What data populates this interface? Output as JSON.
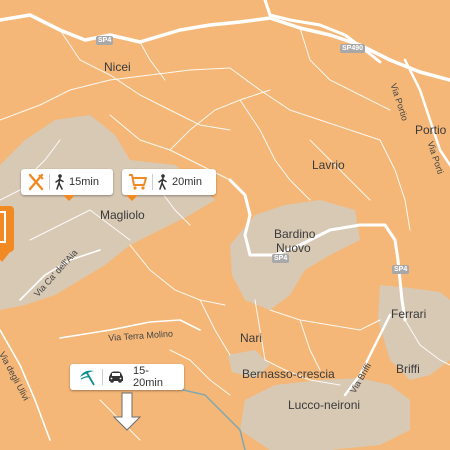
{
  "places": {
    "nicei": "Nicei",
    "lavrio": "Lavrio",
    "portio": "Portio",
    "magliolo": "Magliolo",
    "bardino_nuovo_line1": "Bardino",
    "bardino_nuovo_line2": "Nuovo",
    "ferrari": "Ferrari",
    "nari": "Nari",
    "briffi": "Briffi",
    "bernasso": "Bernasso-crescia",
    "lucco": "Lucco-neironi"
  },
  "roads": {
    "sp4_top": "SP4",
    "sp490": "SP490",
    "sp4_mid": "SP4",
    "sp4_right": "SP4",
    "via_portio_a": "Via Portio",
    "via_portio_b": "Via Porti",
    "via_ca_dellaia": "Via Ca' dell'Aia",
    "via_terra_molino": "Via Terra Molino",
    "via_degli_ulivi": "Via degli Ulivi",
    "via_briffi": "Via Briffi"
  },
  "chips": {
    "restaurant_walk": {
      "icon": "restaurant-icon",
      "mode_icon": "walking-icon",
      "time": "15min"
    },
    "shop_walk": {
      "icon": "shopping-cart-icon",
      "mode_icon": "walking-icon",
      "time": "20min"
    },
    "beach_drive": {
      "icon": "beach-umbrella-icon",
      "mode_icon": "car-icon",
      "time": "15-20min"
    }
  },
  "colors": {
    "land": "#f4b777",
    "urban": "#d8c9b5",
    "road": "#ffffff",
    "marker": "#f28a24",
    "beach": "#0a8f8a",
    "river": "#7fa6b3"
  }
}
